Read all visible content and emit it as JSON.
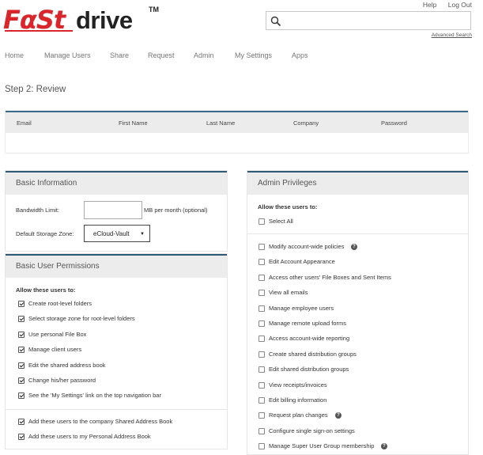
{
  "brand": {
    "part1": "FαSt",
    "part2": "drive",
    "tm": "TM"
  },
  "top_links": {
    "help": "Help",
    "logout": "Log Out"
  },
  "search": {
    "placeholder": "",
    "advanced": "Advanced Search"
  },
  "nav": [
    "Home",
    "Manage Users",
    "Share",
    "Request",
    "Admin",
    "My Settings",
    "Apps"
  ],
  "page": {
    "step_title": "Step 2: Review"
  },
  "review_table": {
    "columns": [
      "Email",
      "First Name",
      "Last Name",
      "Company",
      "Password"
    ]
  },
  "basic_info": {
    "title": "Basic Information",
    "bandwidth_label": "Bandwidth Limit:",
    "bandwidth_value": "",
    "bandwidth_suffix": "MB per month (optional)",
    "storage_label": "Default Storage Zone:",
    "storage_value": "eCloud-Vault"
  },
  "basic_permissions": {
    "title": "Basic User Permissions",
    "allow_title": "Allow these users to:",
    "items": [
      {
        "label": "Create root-level folders",
        "checked": true
      },
      {
        "label": "Select storage zone for root-level folders",
        "checked": true
      },
      {
        "label": "Use personal File Box",
        "checked": true
      },
      {
        "label": "Manage client users",
        "checked": true
      },
      {
        "label": "Edit the shared address book",
        "checked": true
      },
      {
        "label": "Change his/her password",
        "checked": true
      },
      {
        "label": "See the 'My Settings' link on the top navigation bar",
        "checked": true
      }
    ],
    "extra": [
      {
        "label": "Add these users to the company Shared Address Book",
        "checked": true
      },
      {
        "label": "Add these users to my Personal Address Book",
        "checked": true
      }
    ]
  },
  "admin_privileges": {
    "title": "Admin Privileges",
    "allow_title": "Allow these users to:",
    "select_all": "Select All",
    "items": [
      {
        "label": "Modify account-wide policies",
        "help": true,
        "checked": false
      },
      {
        "label": "Edit Account Appearance",
        "help": false,
        "checked": false
      },
      {
        "label": "Access other users' File Boxes and Sent Items",
        "help": false,
        "checked": false
      },
      {
        "label": "View all emails",
        "help": false,
        "checked": false
      },
      {
        "label": "Manage employee users",
        "help": false,
        "checked": false
      },
      {
        "label": "Manage remote upload forms",
        "help": false,
        "checked": false
      },
      {
        "label": "Access account-wide reporting",
        "help": false,
        "checked": false
      },
      {
        "label": "Create shared distribution groups",
        "help": false,
        "checked": false
      },
      {
        "label": "Edit shared distribution groups",
        "help": false,
        "checked": false
      },
      {
        "label": "View receipts/invoices",
        "help": false,
        "checked": false
      },
      {
        "label": "Edit billing information",
        "help": false,
        "checked": false
      },
      {
        "label": "Request plan changes",
        "help": true,
        "checked": false
      },
      {
        "label": "Configure single sign-on settings",
        "help": false,
        "checked": false
      },
      {
        "label": "Manage Super User Group membership",
        "help": true,
        "checked": false
      }
    ]
  }
}
